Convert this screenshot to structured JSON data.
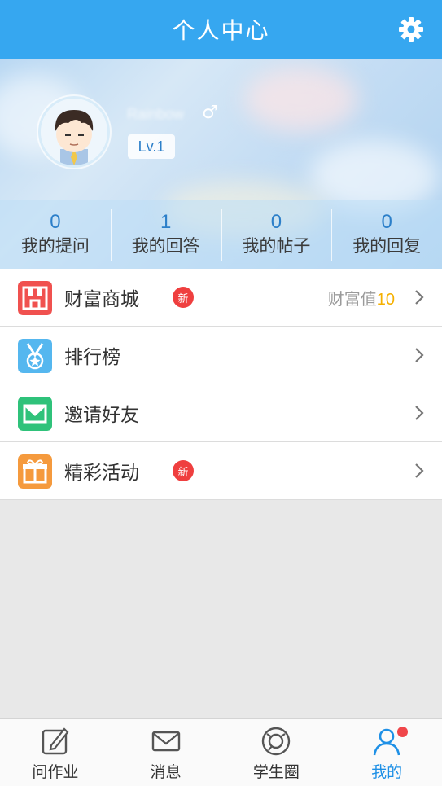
{
  "header": {
    "title": "个人中心",
    "settings_icon": "gear-icon"
  },
  "profile": {
    "username": "Rainbow",
    "gender_symbol": "♂",
    "level": "Lv.1"
  },
  "stats": [
    {
      "value": "0",
      "label": "我的提问"
    },
    {
      "value": "1",
      "label": "我的回答"
    },
    {
      "value": "0",
      "label": "我的帖子"
    },
    {
      "value": "0",
      "label": "我的回复"
    }
  ],
  "menu": {
    "items": [
      {
        "label": "财富商城",
        "icon": "store-icon",
        "badge": "新",
        "extra_label": "财富值",
        "extra_value": "10"
      },
      {
        "label": "排行榜",
        "icon": "medal-icon"
      },
      {
        "label": "邀请好友",
        "icon": "envelope-icon"
      },
      {
        "label": "精彩活动",
        "icon": "gift-icon",
        "badge": "新"
      }
    ]
  },
  "tabbar": {
    "items": [
      {
        "label": "问作业",
        "icon": "edit-icon"
      },
      {
        "label": "消息",
        "icon": "mail-icon"
      },
      {
        "label": "学生圈",
        "icon": "circle-icon"
      },
      {
        "label": "我的",
        "icon": "user-icon",
        "active": true
      }
    ]
  },
  "colors": {
    "brand": "#36a7f0",
    "badge": "#ef3f3f",
    "wealth": "#f5b000"
  }
}
